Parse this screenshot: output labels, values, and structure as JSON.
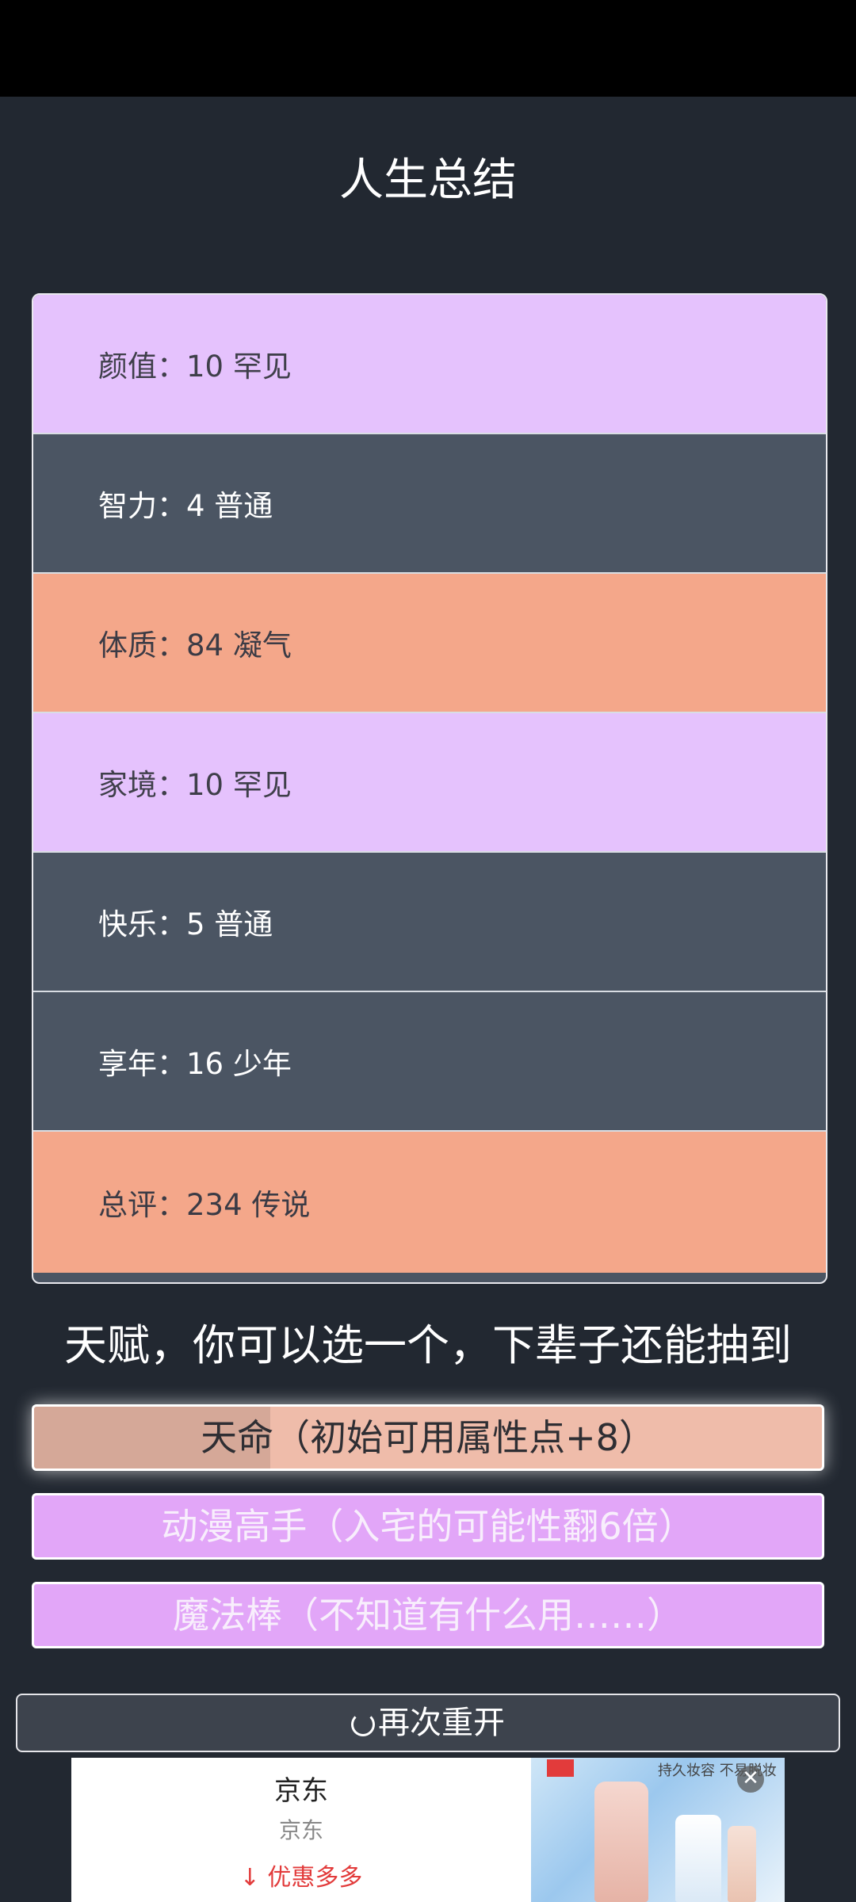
{
  "page": {
    "title": "人生总结"
  },
  "stats": [
    {
      "label": "颜值：10 罕见",
      "grade": "rare"
    },
    {
      "label": "智力：4 普通",
      "grade": "common"
    },
    {
      "label": "体质：84 凝气",
      "grade": "epic"
    },
    {
      "label": "家境：10 罕见",
      "grade": "rare"
    },
    {
      "label": "快乐：5 普通",
      "grade": "common"
    },
    {
      "label": "享年：16 少年",
      "grade": "common"
    },
    {
      "label": "总评：234 传说",
      "grade": "epic"
    }
  ],
  "talents": {
    "heading": "天赋，你可以选一个，下辈子还能抽到",
    "items": [
      {
        "label": "天命（初始可用属性点+8）"
      },
      {
        "label": "动漫高手（入宅的可能性翻6倍）"
      },
      {
        "label": "魔法棒（不知道有什么用……）"
      }
    ]
  },
  "actions": {
    "restart_label": "再次重开"
  },
  "ad": {
    "brand": "京东",
    "subtitle": "京东",
    "cta": "↓ 优惠多多",
    "slogan": "持久妆容 不易脱妆",
    "close_glyph": "✕"
  },
  "colors": {
    "rare": "#e5c2fd",
    "common": "#4b5563",
    "epic": "#f4a78a",
    "talent_pink": "#e2a6f8"
  }
}
